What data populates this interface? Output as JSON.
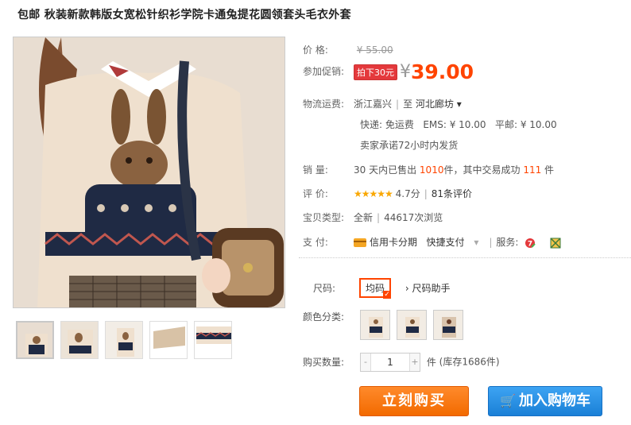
{
  "title": "包邮 秋装新款韩版女宽松针织衫学院卡通兔提花圆领套头毛衣外套",
  "price": {
    "label": "价      格:",
    "original": "¥ 55.00"
  },
  "promo": {
    "label": "参加促销:",
    "tag": "拍下30元",
    "yen": "¥",
    "price": "39.00"
  },
  "shipping": {
    "label": "物流运费:",
    "from": "浙江嘉兴",
    "to_prefix": "至",
    "to": "河北廊坊",
    "dropdown": "▾",
    "express": "快递: 免运费",
    "ems": "EMS: ¥ 10.00",
    "mail": "平邮: ¥ 10.00",
    "promise": "卖家承诺72小时内发货"
  },
  "sales": {
    "label": "销      量:",
    "prefix": "30 天内已售出",
    "sold": "1010",
    "mid": "件，其中交易成功",
    "success": "111",
    "suffix": "件"
  },
  "rating": {
    "label": "评      价:",
    "stars": "★★★★★",
    "score": "4.7分",
    "reviews": "81条评价"
  },
  "item_type": {
    "label": "宝贝类型:",
    "condition": "全新",
    "views": "44617次浏览"
  },
  "payment": {
    "label": "支      付:",
    "installment": "信用卡分期",
    "quick": "快捷支付",
    "services_label": "服务:"
  },
  "size": {
    "label": "尺码:",
    "selected": "均码",
    "helper": "尺码助手"
  },
  "color": {
    "label": "颜色分类:"
  },
  "quantity": {
    "label": "购买数量:",
    "minus": "-",
    "value": "1",
    "plus": "+",
    "unit": "件",
    "stock": "(库存1686件)"
  },
  "buttons": {
    "buy": "立刻购买",
    "cart": "加入购物车"
  },
  "colors": {
    "accent": "#ff4400",
    "buy": "#f26a00",
    "cart": "#1a7fd6"
  }
}
